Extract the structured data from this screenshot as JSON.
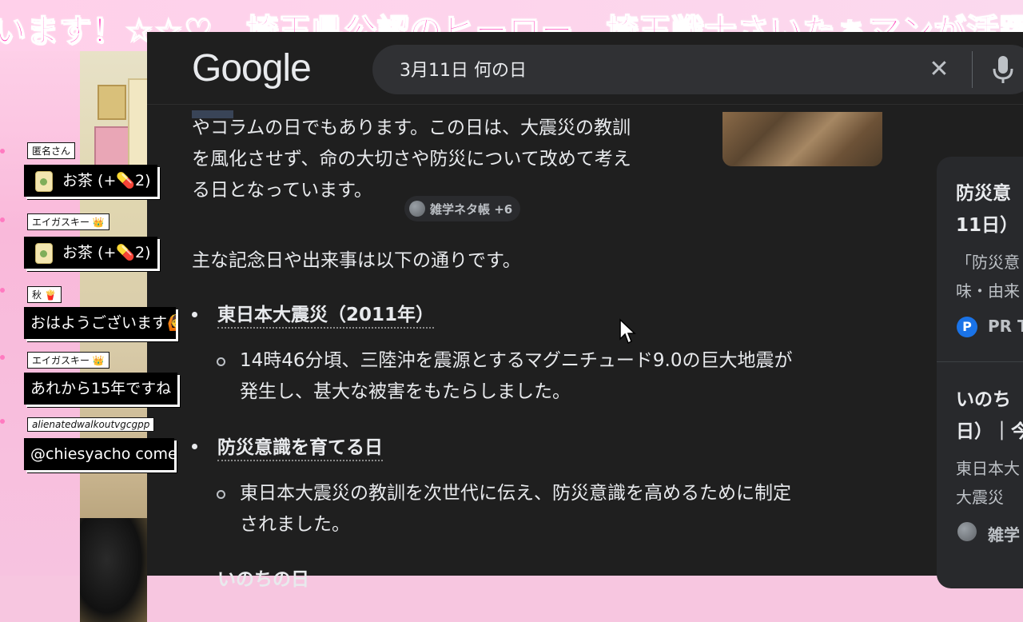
{
  "banner": {
    "text": "います！☆☆♡　埼玉県公認のヒーロー、埼玉戦士さいたぁマンが活躍"
  },
  "google": {
    "logo": "Google",
    "search_query": "3月11日 何の日",
    "clear_icon": "close-icon",
    "mic_icon": "mic-icon"
  },
  "article": {
    "paragraph_lines": [
      "やコラムの日でもあります。この日は、大震災の教訓",
      "を風化させず、命の大切さや防災について改めて考え",
      "る日となっています。"
    ],
    "source_chip": "雑学ネタ帳 +6",
    "intro": "主な記念日や出来事は以下の通りです。",
    "bullets": [
      {
        "title": "東日本大震災（2011年）",
        "sub_lines": [
          "14時46分頃、三陸沖を震源とするマグニチュード9.0の巨大地震が",
          "発生し、甚大な被害をもたらしました。"
        ]
      },
      {
        "title": "防災意識を育てる日",
        "sub_lines": [
          "東日本大震災の教訓を次世代に伝え、防災意識を高めるために制定",
          "されました。"
        ]
      },
      {
        "title": "いのちの日",
        "sub_lines": []
      }
    ]
  },
  "right_panel": {
    "card1_title_line1": "防災意",
    "card1_title_line2": "11日）",
    "card1_snippet_line1": "「防災意",
    "card1_snippet_line2": "味・由来",
    "card1_source": "PR T",
    "card2_title_line1": "いのち",
    "card2_title_line2": "日）｜今",
    "card2_snippet_line1": "東日本大",
    "card2_snippet_line2": "大震災",
    "card2_source": "雑学"
  },
  "chat": [
    {
      "user": "匿名さん",
      "message": "お茶 (+💊2)",
      "type": "tea"
    },
    {
      "user": "エイガスキー 👑",
      "message": "お茶 (+💊2)",
      "type": "tea"
    },
    {
      "user": "秋 🍟",
      "message": "おはようございます🙆",
      "type": "text"
    },
    {
      "user": "エイガスキー 👑",
      "message": "あれから15年ですね",
      "type": "text"
    },
    {
      "user": "alienatedwalkoutvgcgpp",
      "message": "@chiesyacho come",
      "type": "text"
    }
  ]
}
